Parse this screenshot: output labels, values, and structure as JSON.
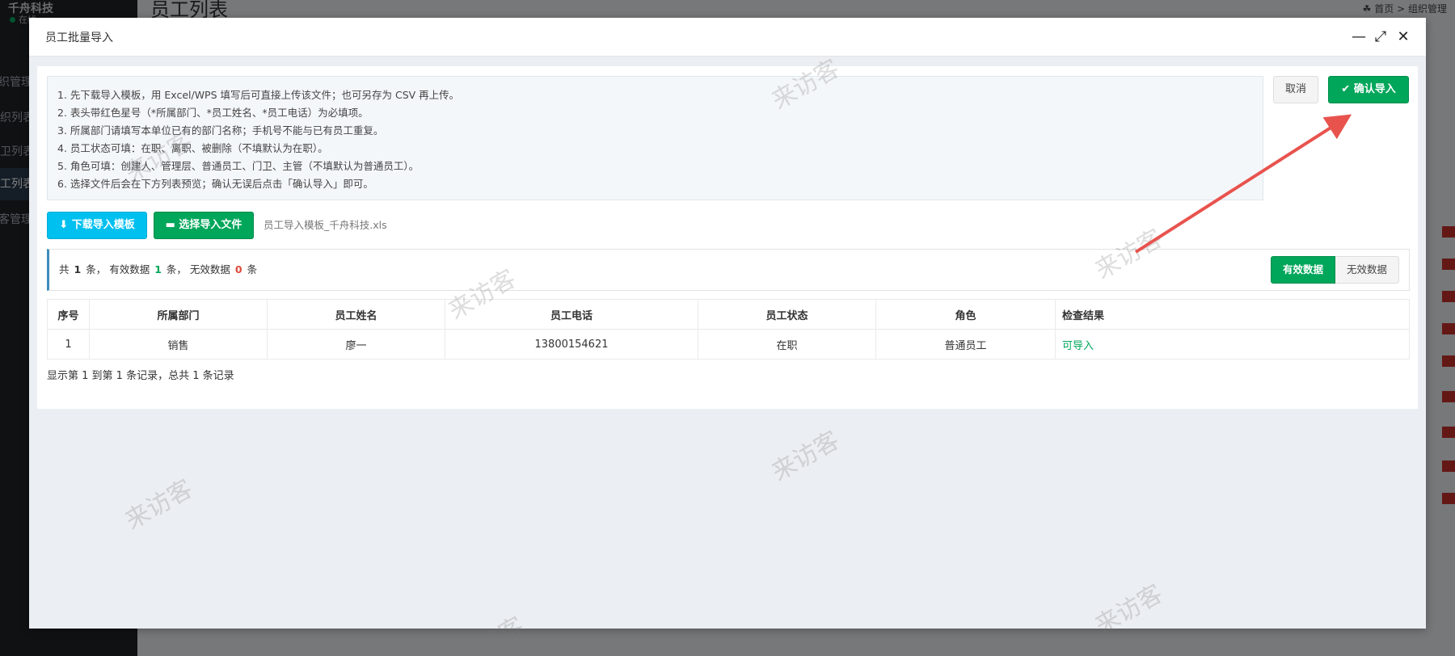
{
  "background": {
    "brand": "千舟科技",
    "status": "在线",
    "menu": [
      "组织管理",
      "组织列表",
      "门卫列表",
      "员工列表",
      "访客管理"
    ],
    "page_title": "员工列表",
    "breadcrumb": [
      "首页",
      "组织管理"
    ]
  },
  "modal": {
    "title": "员工批量导入",
    "tools": {
      "minimize": "—",
      "maximize": "⤢",
      "close": "✕"
    },
    "instructions": [
      "1. 先下载导入模板，用 Excel/WPS 填写后可直接上传该文件；也可另存为 CSV 再上传。",
      "2. 表头带红色星号（*所属部门、*员工姓名、*员工电话）为必填项。",
      "3. 所属部门请填写本单位已有的部门名称；手机号不能与已有员工重复。",
      "4. 员工状态可填：在职、离职、被删除（不填默认为在职）。",
      "5. 角色可填：创建人、管理层、普通员工、门卫、主管（不填默认为普通员工）。",
      "6. 选择文件后会在下方列表预览；确认无误后点击「确认导入」即可。"
    ],
    "cancel_label": "取消",
    "confirm_label": "确认导入",
    "download_label": "下载导入模板",
    "select_label": "选择导入文件",
    "filename": "员工导入模板_千舟科技.xls",
    "summary": {
      "prefix": "共",
      "total": "1",
      "unit1": "条，",
      "valid_label": "有效数据",
      "valid": "1",
      "unit2": "条，",
      "invalid_label": "无效数据",
      "invalid": "0",
      "unit3": "条"
    },
    "toggle": {
      "valid": "有效数据",
      "invalid": "无效数据"
    },
    "table": {
      "headers": [
        "序号",
        "所属部门",
        "员工姓名",
        "员工电话",
        "员工状态",
        "角色",
        "检查结果"
      ],
      "rows": [
        [
          "1",
          "销售",
          "廖一",
          "13800154621",
          "在职",
          "普通员工",
          "可导入"
        ]
      ]
    },
    "pager": "显示第 1 到第 1 条记录，总共 1 条记录"
  },
  "watermark": "来访客",
  "colors": {
    "primary_green": "#00a65a",
    "info_cyan": "#00c0ef",
    "danger_red": "#dd4b39",
    "arrow": "#e8534e"
  }
}
